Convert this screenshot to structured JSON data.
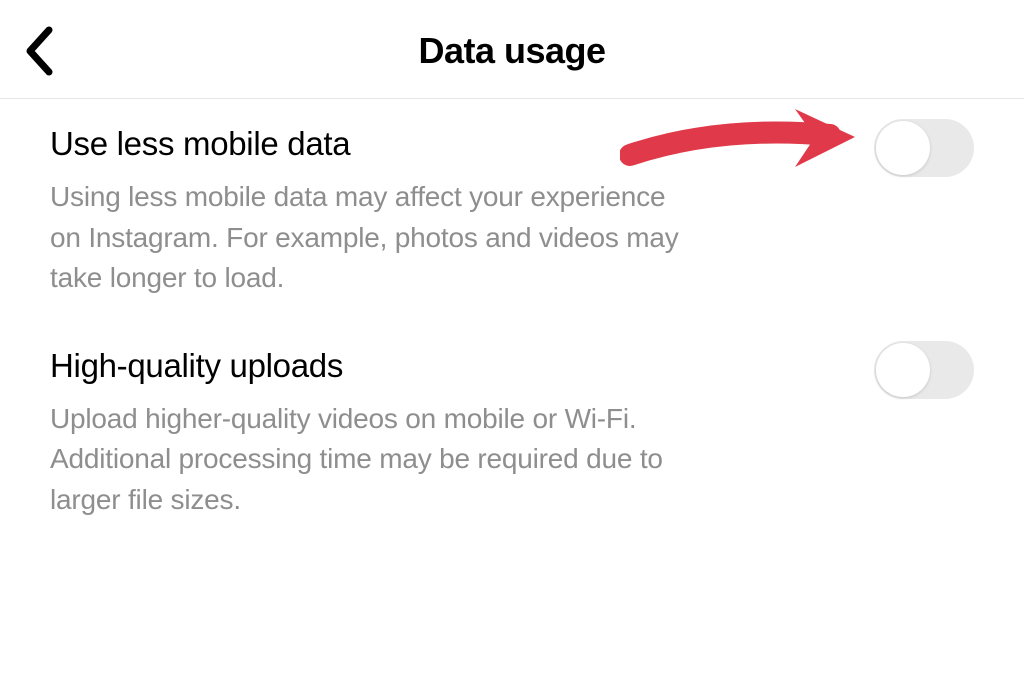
{
  "header": {
    "title": "Data usage"
  },
  "settings": [
    {
      "title": "Use less mobile data",
      "description": "Using less mobile data may affect your experience on Instagram. For example, photos and videos may take longer to load.",
      "enabled": false
    },
    {
      "title": "High-quality uploads",
      "description": "Upload higher-quality videos on mobile or Wi-Fi. Additional processing time may be required due to larger file sizes.",
      "enabled": false
    }
  ],
  "annotation": {
    "color": "#e03a4a"
  }
}
